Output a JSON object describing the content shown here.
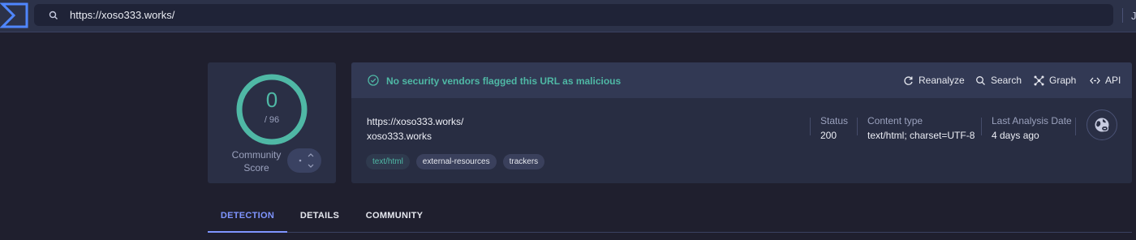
{
  "search": {
    "value": "https://xoso333.works/"
  },
  "topbar": {
    "user_initial": "J"
  },
  "score": {
    "value": "0",
    "total": "/ 96",
    "community_label": "Community Score"
  },
  "header": {
    "status_message": "No security vendors flagged this URL as malicious",
    "actions": {
      "reanalyze": "Reanalyze",
      "search": "Search",
      "graph": "Graph",
      "api": "API"
    }
  },
  "info": {
    "url": "https://xoso333.works/",
    "domain": "xoso333.works",
    "tags": [
      "text/html",
      "external-resources",
      "trackers"
    ],
    "status_label": "Status",
    "status_value": "200",
    "content_type_label": "Content type",
    "content_type_value": "text/html; charset=UTF-8",
    "last_analysis_label": "Last Analysis Date",
    "last_analysis_value": "4 days ago"
  },
  "tabs": {
    "detection": "DETECTION",
    "details": "DETAILS",
    "community": "COMMUNITY"
  },
  "colors": {
    "accent_green": "#4fb8a5",
    "accent_blue": "#7f95ff",
    "background": "#1f1f2e"
  }
}
